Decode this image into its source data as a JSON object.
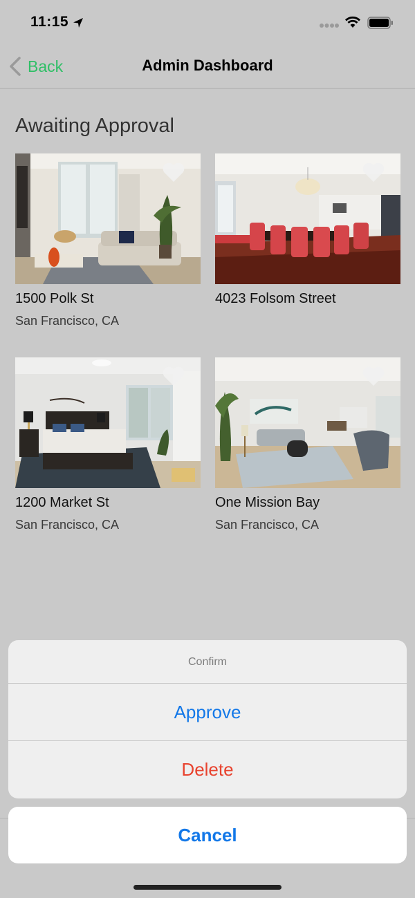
{
  "status_bar": {
    "time": "11:15"
  },
  "nav": {
    "back_label": "Back",
    "title": "Admin Dashboard"
  },
  "section": {
    "title": "Awaiting Approval"
  },
  "listings": [
    {
      "title": "1500 Polk St",
      "subtitle": "San Francisco, CA"
    },
    {
      "title": "4023 Folsom Street",
      "subtitle": ""
    },
    {
      "title": "1200 Market St",
      "subtitle": "San Francisco, CA"
    },
    {
      "title": "One Mission Bay",
      "subtitle": "San Francisco, CA"
    }
  ],
  "action_sheet": {
    "title": "Confirm",
    "approve_label": "Approve",
    "delete_label": "Delete",
    "cancel_label": "Cancel"
  },
  "colors": {
    "accent_green": "#2fbf66",
    "action_blue": "#1378e8",
    "destructive_red": "#e8432f"
  },
  "icons": [
    "location-arrow-icon",
    "cellular-signal-icon",
    "wifi-icon",
    "battery-icon",
    "chevron-left-icon",
    "heart-icon"
  ]
}
